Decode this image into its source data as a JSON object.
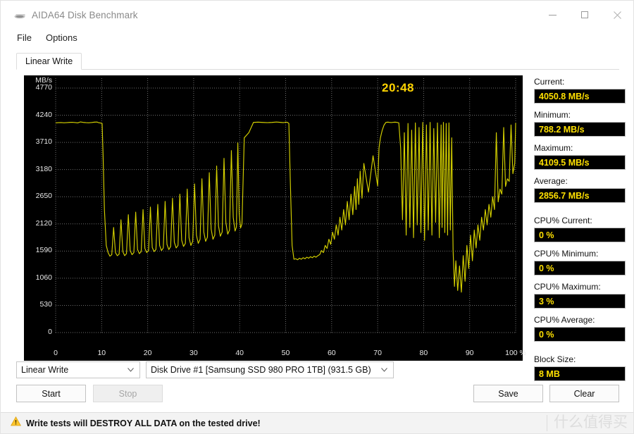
{
  "window": {
    "title": "AIDA64 Disk Benchmark",
    "icon": "disk-icon",
    "minimize": "–",
    "maximize": "□",
    "close": "✕"
  },
  "menu": {
    "items": [
      "File",
      "Options"
    ]
  },
  "tabs": [
    {
      "label": "Linear Write",
      "active": true
    }
  ],
  "chart_panel": {
    "timer": "20:48",
    "unit_label": "MB/s",
    "x_unit": "%"
  },
  "stats": [
    {
      "label": "Current:",
      "value": "4050.8 MB/s"
    },
    {
      "label": "Minimum:",
      "value": "788.2 MB/s"
    },
    {
      "label": "Maximum:",
      "value": "4109.5 MB/s"
    },
    {
      "label": "Average:",
      "value": "2856.7 MB/s"
    },
    {
      "label": "CPU% Current:",
      "value": "0 %"
    },
    {
      "label": "CPU% Minimum:",
      "value": "0 %"
    },
    {
      "label": "CPU% Maximum:",
      "value": "3 %"
    },
    {
      "label": "CPU% Average:",
      "value": "0 %"
    },
    {
      "label": "Block Size:",
      "value": "8 MB"
    }
  ],
  "controls": {
    "test_select": {
      "value": "Linear Write",
      "caret": "⌄"
    },
    "drive_select": {
      "value": "Disk Drive #1  [Samsung SSD 980 PRO 1TB]  (931.5 GB)",
      "caret": "⌄"
    },
    "start_button": "Start",
    "stop_button": "Stop",
    "stop_disabled": true,
    "save_button": "Save",
    "clear_button": "Clear"
  },
  "statusbar": {
    "warning_icon": "warning-triangle-icon",
    "warning_text": "Write tests will DESTROY ALL DATA on the tested drive!",
    "watermark": "什么值得买"
  },
  "colors": {
    "trace": "#d4d000",
    "value_text": "#ffe000",
    "chart_bg": "#000000",
    "grid": "#6e6e6e",
    "accent_warning": "#ffc107"
  },
  "chart_data": {
    "type": "line",
    "title": "Linear Write",
    "xlabel": "%",
    "ylabel": "MB/s",
    "xlim": [
      0,
      100
    ],
    "ylim": [
      0,
      4770
    ],
    "grid": true,
    "legend": false,
    "yticks": [
      0,
      530,
      1060,
      1590,
      2120,
      2650,
      3180,
      3710,
      4240,
      4770
    ],
    "xticks": [
      0,
      10,
      20,
      30,
      40,
      50,
      60,
      70,
      80,
      90,
      100
    ],
    "annotations": [
      {
        "text": "20:48",
        "x": 72,
        "y": 4600
      }
    ],
    "summary": {
      "current": 4050.8,
      "minimum": 788.2,
      "maximum": 4109.5,
      "average": 2856.7,
      "block_size_mb": 8
    },
    "series": [
      {
        "name": "Linear Write",
        "color": "#d4d000",
        "x": [
          0,
          0.6,
          1.2,
          1.8,
          2.4,
          3,
          3.6,
          4.2,
          4.8,
          5.4,
          6,
          6.6,
          7.2,
          7.8,
          8.4,
          9,
          9.3,
          9.6,
          9.9,
          10.1,
          10.3,
          10.6,
          11,
          11.4,
          11.8,
          12.2,
          12.6,
          13,
          13.4,
          13.8,
          14.2,
          14.6,
          15,
          15.4,
          15.8,
          16.2,
          16.6,
          17,
          17.4,
          17.8,
          18.2,
          18.6,
          19,
          19.4,
          19.8,
          20.2,
          20.6,
          21,
          21.4,
          21.8,
          22.2,
          22.6,
          23,
          23.4,
          23.8,
          24.2,
          24.6,
          25,
          25.4,
          25.8,
          26.2,
          26.6,
          27,
          27.4,
          27.8,
          28.2,
          28.6,
          29,
          29.4,
          29.8,
          30.2,
          30.6,
          31,
          31.4,
          31.8,
          32.2,
          32.6,
          33,
          33.4,
          33.8,
          34.2,
          34.6,
          35,
          35.4,
          35.8,
          36.2,
          36.6,
          37,
          37.4,
          37.8,
          38.2,
          38.6,
          39,
          39.3,
          39.6,
          39.9,
          40.2,
          40.5,
          41,
          42,
          43,
          44,
          45,
          46,
          47,
          48,
          49,
          49.5,
          49.8,
          50.1,
          50.4,
          50.7,
          51,
          51.4,
          51.8,
          52.2,
          52.6,
          53,
          53.4,
          53.8,
          54.2,
          54.6,
          55,
          55.4,
          55.8,
          56.2,
          56.6,
          57,
          57.4,
          57.8,
          58.2,
          58.6,
          59,
          59.4,
          59.8,
          60.2,
          60.6,
          61,
          61.4,
          61.8,
          62.2,
          62.6,
          63,
          63.4,
          63.8,
          64.2,
          64.6,
          65,
          65.3,
          65.6,
          65.9,
          66.2,
          66.6,
          67,
          68,
          69,
          70,
          70.3,
          70.6,
          71,
          71.4,
          71.8,
          72.2,
          72.6,
          73,
          73.4,
          73.8,
          74.2,
          74.6,
          75,
          75.4,
          75.8,
          76.2,
          76.6,
          77,
          77.4,
          77.8,
          78.2,
          78.6,
          79,
          79.4,
          79.8,
          80.2,
          80.6,
          81,
          81.4,
          81.8,
          82.2,
          82.6,
          83,
          83.4,
          83.8,
          84,
          84.3,
          84.6,
          84.9,
          85.2,
          85.5,
          85.8,
          86.1,
          86.4,
          86.7,
          87,
          87.4,
          87.8,
          88.2,
          88.6,
          89,
          89.4,
          89.8,
          90.2,
          90.6,
          91,
          91.4,
          91.8,
          92.2,
          92.6,
          93,
          93.4,
          93.8,
          94.2,
          94.6,
          95,
          95.4,
          95.8,
          96.2,
          96.6,
          97,
          97.4,
          97.8,
          98.2,
          98.6,
          99,
          99.4,
          99.8,
          100
        ],
        "y": [
          4090,
          4095,
          4098,
          4092,
          4096,
          4100,
          4103,
          4098,
          4090,
          4110,
          4100,
          4095,
          4092,
          4098,
          4105,
          4108,
          4095,
          4090,
          4085,
          4080,
          3500,
          2400,
          1700,
          1560,
          1490,
          1520,
          2050,
          1560,
          1500,
          1530,
          2200,
          1580,
          1500,
          1540,
          2300,
          1600,
          1520,
          1560,
          2350,
          1620,
          1540,
          1580,
          2400,
          1640,
          1560,
          1600,
          2450,
          1660,
          1580,
          1620,
          2500,
          1700,
          1600,
          1650,
          2560,
          1720,
          1620,
          1680,
          2620,
          1760,
          1650,
          1700,
          2700,
          1800,
          1680,
          1740,
          2800,
          1850,
          1700,
          1780,
          2900,
          1900,
          1740,
          1820,
          3000,
          1960,
          1780,
          1860,
          3120,
          2020,
          1820,
          1900,
          3250,
          2080,
          1880,
          1960,
          3400,
          2150,
          1920,
          2000,
          3550,
          2250,
          1980,
          2060,
          3700,
          2320,
          2040,
          2120,
          3800,
          3900,
          4100,
          4105,
          4100,
          4095,
          4100,
          4108,
          4100,
          4096,
          4100,
          4105,
          4100,
          4080,
          3000,
          1700,
          1430,
          1440,
          1420,
          1450,
          1430,
          1460,
          1440,
          1470,
          1450,
          1480,
          1460,
          1490,
          1470,
          1500,
          1520,
          1600,
          1560,
          1700,
          1640,
          1820,
          1720,
          1960,
          1820,
          2100,
          1900,
          2250,
          2000,
          2400,
          2100,
          2560,
          2200,
          2700,
          2300,
          2850,
          2400,
          3000,
          2500,
          3150,
          2620,
          3300,
          2740,
          3450,
          2860,
          3600,
          3800,
          3950,
          4050,
          4100,
          4105,
          4100,
          4098,
          4102,
          4105,
          4100,
          4090,
          3600,
          2200,
          3900,
          1900,
          4080,
          2050,
          3950,
          1850,
          4090,
          2100,
          4000,
          1950,
          4100,
          1800,
          4050,
          2000,
          4100,
          1900,
          3980,
          2150,
          4090,
          1850,
          4050,
          2050,
          4100,
          1950,
          4080,
          1900,
          4090,
          2000,
          3800,
          1600,
          900,
          1400,
          820,
          1300,
          788,
          1500,
          1000,
          1700,
          1250,
          1900,
          1400,
          2000,
          1650,
          2100,
          1800,
          2250,
          2000,
          2400,
          2100,
          2500,
          2250,
          2650,
          2400,
          3900,
          2550,
          2800,
          2700,
          4000,
          2850,
          3000,
          2950,
          4050,
          3100,
          3300,
          4090,
          3400,
          4100,
          3500,
          4080,
          3650,
          4100,
          3800,
          4109
        ]
      }
    ]
  }
}
